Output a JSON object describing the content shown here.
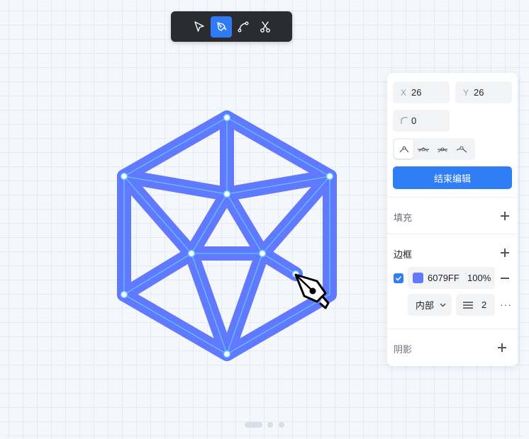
{
  "toolbar": {
    "tools": [
      {
        "icon": "pointer-arrow-icon",
        "active": false
      },
      {
        "icon": "pen-tool-icon",
        "active": true
      },
      {
        "icon": "bezier-curve-icon",
        "active": false
      },
      {
        "icon": "scissors-icon",
        "active": false
      }
    ]
  },
  "colors": {
    "shape_stroke": "#6079FF",
    "path_line": "#5ec8ff",
    "accent": "#2f7ef6"
  },
  "panel": {
    "x_label": "X",
    "x_value": "26",
    "y_label": "Y",
    "y_value": "26",
    "radius_value": "0",
    "node_modes": [
      "sharp-node-icon",
      "mirrored-node-icon",
      "asymmetric-node-icon",
      "disconnected-node-icon"
    ],
    "finish_label": "结束编辑",
    "fill_title": "填充",
    "border_title": "边框",
    "border_enabled": true,
    "border_color": "6079FF",
    "border_opacity": "100%",
    "border_position": "内部",
    "border_width": "2",
    "shadow_title": "阴影"
  },
  "pager": {
    "count": 3,
    "active": 0
  }
}
